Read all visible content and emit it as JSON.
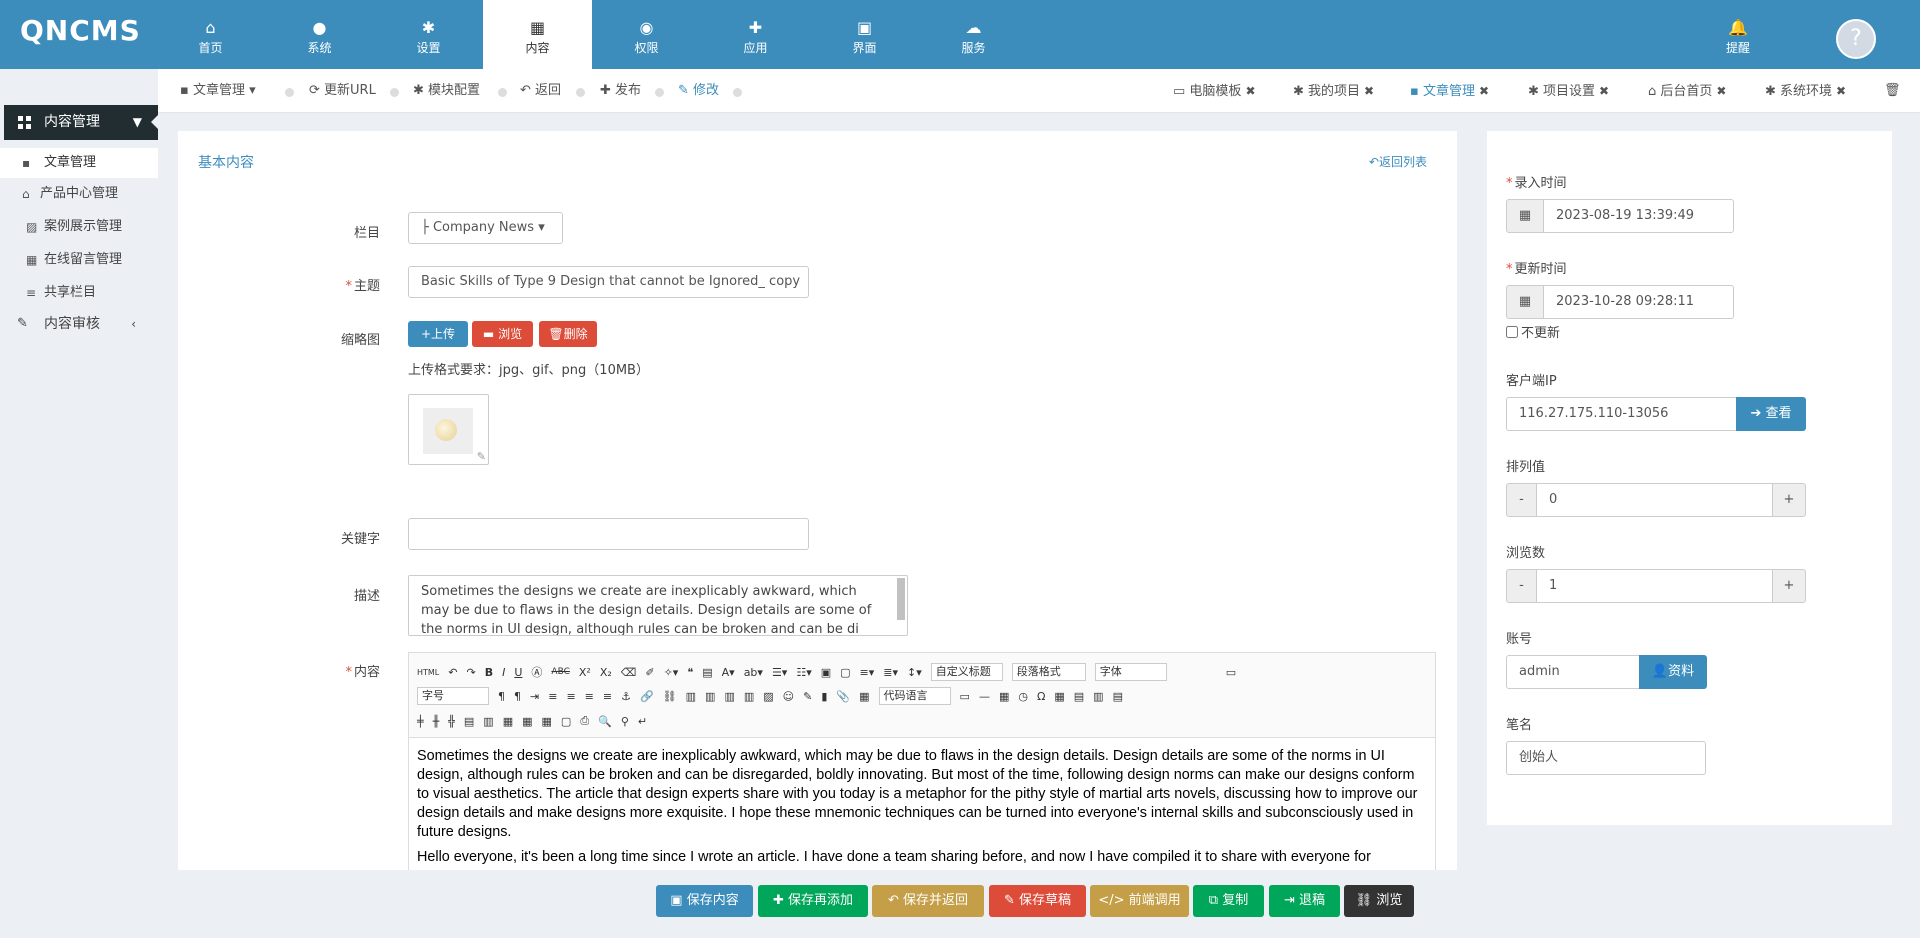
{
  "app": {
    "logo": "QNCMS"
  },
  "topnav": [
    {
      "icon": "⌂",
      "label": "首页"
    },
    {
      "icon": "●",
      "label": "系统"
    },
    {
      "icon": "✱",
      "label": "设置"
    },
    {
      "icon": "▦",
      "label": "内容"
    },
    {
      "icon": "◉",
      "label": "权限"
    },
    {
      "icon": "✚",
      "label": "应用"
    },
    {
      "icon": "▣",
      "label": "界面"
    },
    {
      "icon": "☁",
      "label": "服务"
    }
  ],
  "notify": {
    "icon": "🔔",
    "label": "提醒"
  },
  "sidebar": {
    "group": "内容管理",
    "items": [
      {
        "icon": "▪",
        "label": "文章管理"
      },
      {
        "icon": "⌂",
        "label": "产品中心管理"
      },
      {
        "icon": "▨",
        "label": "案例展示管理"
      },
      {
        "icon": "▦",
        "label": "在线留言管理"
      },
      {
        "icon": "≡",
        "label": "共享栏目"
      }
    ],
    "audit": "内容审核"
  },
  "actions": {
    "article_manage": "文章管理",
    "update_url": "更新URL",
    "module_config": "模块配置",
    "back": "返回",
    "publish": "发布",
    "edit": "修改"
  },
  "tabs": [
    {
      "label": "电脑模板"
    },
    {
      "label": "我的项目"
    },
    {
      "label": "文章管理"
    },
    {
      "label": "项目设置"
    },
    {
      "label": "后台首页"
    },
    {
      "label": "系统环境"
    }
  ],
  "form": {
    "title": "基本内容",
    "back_list": "返回列表",
    "category_label": "栏目",
    "category_value": "├ Company News",
    "subject_label": "主题",
    "subject_value": "Basic Skills of Type 9 Design that cannot be Ignored_ copy",
    "thumb_label": "缩略图",
    "upload": "上传",
    "browse": "浏览",
    "delete": "删除",
    "upload_hint": "上传格式要求：jpg、gif、png（10MB）",
    "keywords_label": "关键字",
    "keywords_value": "",
    "desc_label": "描述",
    "desc_value": "Sometimes the designs we create are inexplicably awkward, which may be due to flaws in the design details. Design details are some of the norms in UI design, although rules can be broken and can be di",
    "content_label": "内容"
  },
  "editor": {
    "selects": {
      "custom_title": "自定义标题",
      "paragraph": "段落格式",
      "font": "字体",
      "size": "字号",
      "code_lang": "代码语言"
    },
    "paragraphs": [
      "Sometimes the designs we create are inexplicably awkward, which may be due to flaws in the design details. Design details are some of the norms in UI design, although rules can be broken and can be disregarded, boldly innovating. But most of the time, following design norms can make our designs conform to visual aesthetics. The article that design experts share with you today is a metaphor for the pithy style of martial arts novels, discussing how to improve our design details and make designs more exquisite. I hope these mnemonic techniques can be turned into everyone's internal skills and subconsciously used in future designs.",
      "Hello everyone, it's been a long time since I wrote an article. I have done a team sharing before, and now I have compiled it to share with everyone for"
    ]
  },
  "footer": {
    "save": "保存内容",
    "save_add": "保存再添加",
    "save_back": "保存并返回",
    "save_draft": "保存草稿",
    "frontend_call": "前端调用",
    "copy": "复制",
    "revert": "退稿",
    "preview": "浏览",
    "colors": {
      "blue": "#3c8dbc",
      "teal": "#00a65a",
      "gold": "#c49f47",
      "red": "#dd4b39",
      "dark": "#333333"
    }
  },
  "right": {
    "entry_time_label": "录入时间",
    "entry_time": "2023-08-19 13:39:49",
    "update_time_label": "更新时间",
    "update_time": "2023-10-28 09:28:11",
    "no_update": "不更新",
    "client_ip_label": "客户端IP",
    "client_ip": "116.27.175.110-13056",
    "view": "查看",
    "sort_label": "排列值",
    "sort_value": "0",
    "views_label": "浏览数",
    "views_value": "1",
    "account_label": "账号",
    "account_value": "admin",
    "profile": "资料",
    "pen_label": "笔名",
    "pen_value": "创始人"
  }
}
